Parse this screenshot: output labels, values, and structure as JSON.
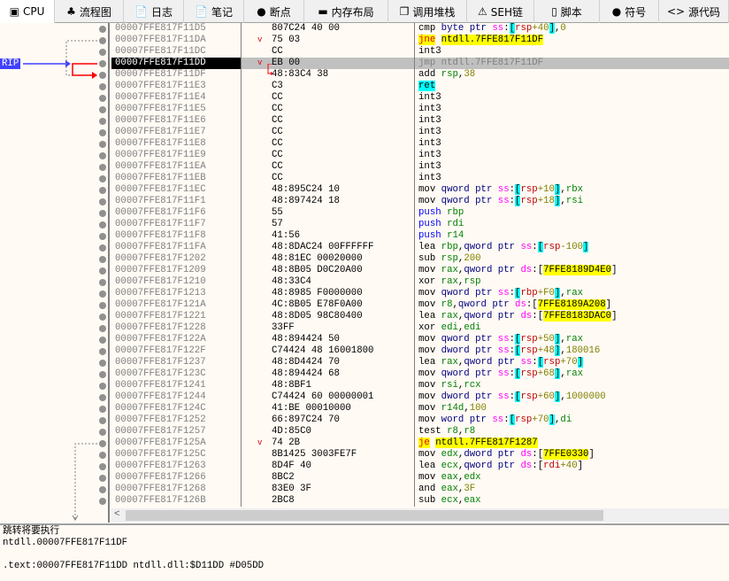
{
  "tabs": [
    {
      "label": "CPU",
      "icon": "cpu-icon",
      "glyph": "▣",
      "active": true
    },
    {
      "label": "流程图",
      "icon": "tree-icon",
      "glyph": "♣"
    },
    {
      "label": "日志",
      "icon": "log-icon",
      "glyph": "📄"
    },
    {
      "label": "笔记",
      "icon": "notes-icon",
      "glyph": "📄"
    },
    {
      "label": "断点",
      "icon": "breakpoint-icon",
      "glyph": "●"
    },
    {
      "label": "内存布局",
      "icon": "memory-icon",
      "glyph": "▬"
    },
    {
      "label": "调用堆栈",
      "icon": "callstack-icon",
      "glyph": "❐"
    },
    {
      "label": "SEH链",
      "icon": "seh-icon",
      "glyph": "⚠"
    },
    {
      "label": "脚本",
      "icon": "script-icon",
      "glyph": "▯"
    },
    {
      "label": "符号",
      "icon": "symbol-icon",
      "glyph": "●"
    },
    {
      "label": "源代码",
      "icon": "source-icon",
      "glyph": "<>"
    }
  ],
  "rip_label": "RIP",
  "selected_index": 3,
  "rows": [
    {
      "addr": "00007FFE817F11D5",
      "bytes": "807C24 40 00",
      "dis": [
        [
          "",
          "cmp "
        ],
        [
          "s",
          "byte ptr "
        ],
        [
          "g",
          "ss"
        ],
        [
          "",
          ":"
        ],
        [
          "b",
          "["
        ],
        [
          "i",
          "rsp"
        ],
        [
          "n",
          "+40"
        ],
        [
          "b",
          "]"
        ],
        [
          "",
          ","
        ],
        [
          "n",
          "0"
        ]
      ]
    },
    {
      "addr": "00007FFE817F11DA",
      "bytes": "75 03",
      "jump": true,
      "dis": [
        [
          "j",
          "jne"
        ],
        [
          "",
          " "
        ],
        [
          "jt",
          "ntdll.7FFE817F11DF"
        ]
      ]
    },
    {
      "addr": "00007FFE817F11DC",
      "bytes": "CC",
      "dis": [
        [
          "",
          "int3"
        ]
      ]
    },
    {
      "addr": "00007FFE817F11DD",
      "bytes": "EB 00",
      "jump": true,
      "dis": [
        [
          "",
          "jmp ntdll.7FFE817F11DF"
        ]
      ]
    },
    {
      "addr": "00007FFE817F11DF",
      "bytes": "48:83C4 38",
      "dis": [
        [
          "",
          "add "
        ],
        [
          "r",
          "rsp"
        ],
        [
          "",
          ","
        ],
        [
          "n",
          "38"
        ]
      ]
    },
    {
      "addr": "00007FFE817F11E3",
      "bytes": "C3",
      "dis": [
        [
          "rt",
          "ret"
        ]
      ]
    },
    {
      "addr": "00007FFE817F11E4",
      "bytes": "CC",
      "dis": [
        [
          "",
          "int3"
        ]
      ]
    },
    {
      "addr": "00007FFE817F11E5",
      "bytes": "CC",
      "dis": [
        [
          "",
          "int3"
        ]
      ]
    },
    {
      "addr": "00007FFE817F11E6",
      "bytes": "CC",
      "dis": [
        [
          "",
          "int3"
        ]
      ]
    },
    {
      "addr": "00007FFE817F11E7",
      "bytes": "CC",
      "dis": [
        [
          "",
          "int3"
        ]
      ]
    },
    {
      "addr": "00007FFE817F11E8",
      "bytes": "CC",
      "dis": [
        [
          "",
          "int3"
        ]
      ]
    },
    {
      "addr": "00007FFE817F11E9",
      "bytes": "CC",
      "dis": [
        [
          "",
          "int3"
        ]
      ]
    },
    {
      "addr": "00007FFE817F11EA",
      "bytes": "CC",
      "dis": [
        [
          "",
          "int3"
        ]
      ]
    },
    {
      "addr": "00007FFE817F11EB",
      "bytes": "CC",
      "dis": [
        [
          "",
          "int3"
        ]
      ]
    },
    {
      "addr": "00007FFE817F11EC",
      "bytes": "48:895C24 10",
      "dis": [
        [
          "",
          "mov "
        ],
        [
          "s",
          "qword ptr "
        ],
        [
          "g",
          "ss"
        ],
        [
          "",
          ":"
        ],
        [
          "b",
          "["
        ],
        [
          "i",
          "rsp"
        ],
        [
          "n",
          "+10"
        ],
        [
          "b",
          "]"
        ],
        [
          "",
          ","
        ],
        [
          "r",
          "rbx"
        ]
      ]
    },
    {
      "addr": "00007FFE817F11F1",
      "bytes": "48:897424 18",
      "dis": [
        [
          "",
          "mov "
        ],
        [
          "s",
          "qword ptr "
        ],
        [
          "g",
          "ss"
        ],
        [
          "",
          ":"
        ],
        [
          "b",
          "["
        ],
        [
          "i",
          "rsp"
        ],
        [
          "n",
          "+18"
        ],
        [
          "b",
          "]"
        ],
        [
          "",
          ","
        ],
        [
          "r",
          "rsi"
        ]
      ]
    },
    {
      "addr": "00007FFE817F11F6",
      "bytes": "55",
      "dis": [
        [
          "p",
          "push "
        ],
        [
          "r",
          "rbp"
        ]
      ]
    },
    {
      "addr": "00007FFE817F11F7",
      "bytes": "57",
      "dis": [
        [
          "p",
          "push "
        ],
        [
          "r",
          "rdi"
        ]
      ]
    },
    {
      "addr": "00007FFE817F11F8",
      "bytes": "41:56",
      "dis": [
        [
          "p",
          "push "
        ],
        [
          "r",
          "r14"
        ]
      ]
    },
    {
      "addr": "00007FFE817F11FA",
      "bytes": "48:8DAC24 00FFFFFF",
      "dis": [
        [
          "",
          "lea "
        ],
        [
          "r",
          "rbp"
        ],
        [
          "",
          ","
        ],
        [
          "s",
          "qword ptr "
        ],
        [
          "g",
          "ss"
        ],
        [
          "",
          ":"
        ],
        [
          "b",
          "["
        ],
        [
          "i",
          "rsp"
        ],
        [
          "n",
          "-100"
        ],
        [
          "b",
          "]"
        ]
      ]
    },
    {
      "addr": "00007FFE817F1202",
      "bytes": "48:81EC 00020000",
      "dis": [
        [
          "",
          "sub "
        ],
        [
          "r",
          "rsp"
        ],
        [
          "",
          ","
        ],
        [
          "n",
          "200"
        ]
      ]
    },
    {
      "addr": "00007FFE817F1209",
      "bytes": "48:8B05 D0C20A00",
      "dis": [
        [
          "",
          "mov "
        ],
        [
          "r",
          "rax"
        ],
        [
          "",
          ","
        ],
        [
          "s",
          "qword ptr "
        ],
        [
          "g",
          "ds"
        ],
        [
          "",
          ":["
        ],
        [
          "a",
          "7FFE8189D4E0"
        ],
        [
          "",
          "]"
        ]
      ]
    },
    {
      "addr": "00007FFE817F1210",
      "bytes": "48:33C4",
      "dis": [
        [
          "",
          "xor "
        ],
        [
          "r",
          "rax"
        ],
        [
          "",
          ","
        ],
        [
          "r",
          "rsp"
        ]
      ]
    },
    {
      "addr": "00007FFE817F1213",
      "bytes": "48:8985 F0000000",
      "dis": [
        [
          "",
          "mov "
        ],
        [
          "s",
          "qword ptr "
        ],
        [
          "g",
          "ss"
        ],
        [
          "",
          ":"
        ],
        [
          "b",
          "["
        ],
        [
          "i",
          "rbp"
        ],
        [
          "n",
          "+F0"
        ],
        [
          "b",
          "]"
        ],
        [
          "",
          ","
        ],
        [
          "r",
          "rax"
        ]
      ]
    },
    {
      "addr": "00007FFE817F121A",
      "bytes": "4C:8B05 E78F0A00",
      "dis": [
        [
          "",
          "mov "
        ],
        [
          "r",
          "r8"
        ],
        [
          "",
          ","
        ],
        [
          "s",
          "qword ptr "
        ],
        [
          "g",
          "ds"
        ],
        [
          "",
          ":["
        ],
        [
          "a",
          "7FFE8189A208"
        ],
        [
          "",
          "]"
        ]
      ]
    },
    {
      "addr": "00007FFE817F1221",
      "bytes": "48:8D05 98C80400",
      "dis": [
        [
          "",
          "lea "
        ],
        [
          "r",
          "rax"
        ],
        [
          "",
          ","
        ],
        [
          "s",
          "qword ptr "
        ],
        [
          "g",
          "ds"
        ],
        [
          "",
          ":["
        ],
        [
          "a",
          "7FFE8183DAC0"
        ],
        [
          "",
          "]"
        ]
      ]
    },
    {
      "addr": "00007FFE817F1228",
      "bytes": "33FF",
      "dis": [
        [
          "",
          "xor "
        ],
        [
          "r",
          "edi"
        ],
        [
          "",
          ","
        ],
        [
          "r",
          "edi"
        ]
      ]
    },
    {
      "addr": "00007FFE817F122A",
      "bytes": "48:894424 50",
      "dis": [
        [
          "",
          "mov "
        ],
        [
          "s",
          "qword ptr "
        ],
        [
          "g",
          "ss"
        ],
        [
          "",
          ":"
        ],
        [
          "b",
          "["
        ],
        [
          "i",
          "rsp"
        ],
        [
          "n",
          "+50"
        ],
        [
          "b",
          "]"
        ],
        [
          "",
          ","
        ],
        [
          "r",
          "rax"
        ]
      ]
    },
    {
      "addr": "00007FFE817F122F",
      "bytes": "C74424 48 16001800",
      "dis": [
        [
          "",
          "mov "
        ],
        [
          "s",
          "dword ptr "
        ],
        [
          "g",
          "ss"
        ],
        [
          "",
          ":"
        ],
        [
          "b",
          "["
        ],
        [
          "i",
          "rsp"
        ],
        [
          "n",
          "+48"
        ],
        [
          "b",
          "]"
        ],
        [
          "",
          ","
        ],
        [
          "n",
          "180016"
        ]
      ]
    },
    {
      "addr": "00007FFE817F1237",
      "bytes": "48:8D4424 70",
      "dis": [
        [
          "",
          "lea "
        ],
        [
          "r",
          "rax"
        ],
        [
          "",
          ","
        ],
        [
          "s",
          "qword ptr "
        ],
        [
          "g",
          "ss"
        ],
        [
          "",
          ":"
        ],
        [
          "b",
          "["
        ],
        [
          "i",
          "rsp"
        ],
        [
          "n",
          "+70"
        ],
        [
          "b",
          "]"
        ]
      ]
    },
    {
      "addr": "00007FFE817F123C",
      "bytes": "48:894424 68",
      "dis": [
        [
          "",
          "mov "
        ],
        [
          "s",
          "qword ptr "
        ],
        [
          "g",
          "ss"
        ],
        [
          "",
          ":"
        ],
        [
          "b",
          "["
        ],
        [
          "i",
          "rsp"
        ],
        [
          "n",
          "+68"
        ],
        [
          "b",
          "]"
        ],
        [
          "",
          ","
        ],
        [
          "r",
          "rax"
        ]
      ]
    },
    {
      "addr": "00007FFE817F1241",
      "bytes": "48:8BF1",
      "dis": [
        [
          "",
          "mov "
        ],
        [
          "r",
          "rsi"
        ],
        [
          "",
          ","
        ],
        [
          "r",
          "rcx"
        ]
      ]
    },
    {
      "addr": "00007FFE817F1244",
      "bytes": "C74424 60 00000001",
      "dis": [
        [
          "",
          "mov "
        ],
        [
          "s",
          "dword ptr "
        ],
        [
          "g",
          "ss"
        ],
        [
          "",
          ":"
        ],
        [
          "b",
          "["
        ],
        [
          "i",
          "rsp"
        ],
        [
          "n",
          "+60"
        ],
        [
          "b",
          "]"
        ],
        [
          "",
          ","
        ],
        [
          "n",
          "1000000"
        ]
      ]
    },
    {
      "addr": "00007FFE817F124C",
      "bytes": "41:BE 00010000",
      "dis": [
        [
          "",
          "mov "
        ],
        [
          "r",
          "r14d"
        ],
        [
          "",
          ","
        ],
        [
          "n",
          "100"
        ]
      ]
    },
    {
      "addr": "00007FFE817F1252",
      "bytes": "66:897C24 70",
      "dis": [
        [
          "",
          "mov "
        ],
        [
          "s",
          "word ptr "
        ],
        [
          "g",
          "ss"
        ],
        [
          "",
          ":"
        ],
        [
          "b",
          "["
        ],
        [
          "i",
          "rsp"
        ],
        [
          "n",
          "+70"
        ],
        [
          "b",
          "]"
        ],
        [
          "",
          ","
        ],
        [
          "r",
          "di"
        ]
      ]
    },
    {
      "addr": "00007FFE817F1257",
      "bytes": "4D:85C0",
      "dis": [
        [
          "",
          "test "
        ],
        [
          "r",
          "r8"
        ],
        [
          "",
          ","
        ],
        [
          "r",
          "r8"
        ]
      ]
    },
    {
      "addr": "00007FFE817F125A",
      "bytes": "74 2B",
      "jump": true,
      "dis": [
        [
          "j",
          "je"
        ],
        [
          "",
          " "
        ],
        [
          "jt",
          "ntdll.7FFE817F1287"
        ]
      ]
    },
    {
      "addr": "00007FFE817F125C",
      "bytes": "8B1425 3003FE7F",
      "dis": [
        [
          "",
          "mov "
        ],
        [
          "r",
          "edx"
        ],
        [
          "",
          ","
        ],
        [
          "s",
          "dword ptr "
        ],
        [
          "g",
          "ds"
        ],
        [
          "",
          ":["
        ],
        [
          "a",
          "7FFE0330"
        ],
        [
          "",
          "]"
        ]
      ]
    },
    {
      "addr": "00007FFE817F1263",
      "bytes": "8D4F 40",
      "dis": [
        [
          "",
          "lea "
        ],
        [
          "r",
          "ecx"
        ],
        [
          "",
          ","
        ],
        [
          "s",
          "qword ptr "
        ],
        [
          "g",
          "ds"
        ],
        [
          "",
          ":["
        ],
        [
          "i",
          "rdi"
        ],
        [
          "n",
          "+40"
        ],
        [
          "",
          "]"
        ]
      ]
    },
    {
      "addr": "00007FFE817F1266",
      "bytes": "8BC2",
      "dis": [
        [
          "",
          "mov "
        ],
        [
          "r",
          "eax"
        ],
        [
          "",
          ","
        ],
        [
          "r",
          "edx"
        ]
      ]
    },
    {
      "addr": "00007FFE817F1268",
      "bytes": "83E0 3F",
      "dis": [
        [
          "",
          "and "
        ],
        [
          "r",
          "eax"
        ],
        [
          "",
          ","
        ],
        [
          "n",
          "3F"
        ]
      ]
    },
    {
      "addr": "00007FFE817F126B",
      "bytes": "2BC8",
      "dis": [
        [
          "",
          "sub "
        ],
        [
          "r",
          "ecx"
        ],
        [
          "",
          ","
        ],
        [
          "r",
          "eax"
        ]
      ]
    }
  ],
  "info": {
    "line1": "跳转将要执行",
    "line2": "ntdll.00007FFE817F11DF",
    "line3": "",
    "line4": ".text:00007FFE817F11DD ntdll.dll:$D11DD #D05DD"
  },
  "colors": {
    "background": "#fffaf4",
    "selection": "#c0c0c0",
    "rip": "#4040ff",
    "jump_arrow": "#ff0000",
    "highlight": "#ffff00",
    "bracket": "#00ffff"
  }
}
